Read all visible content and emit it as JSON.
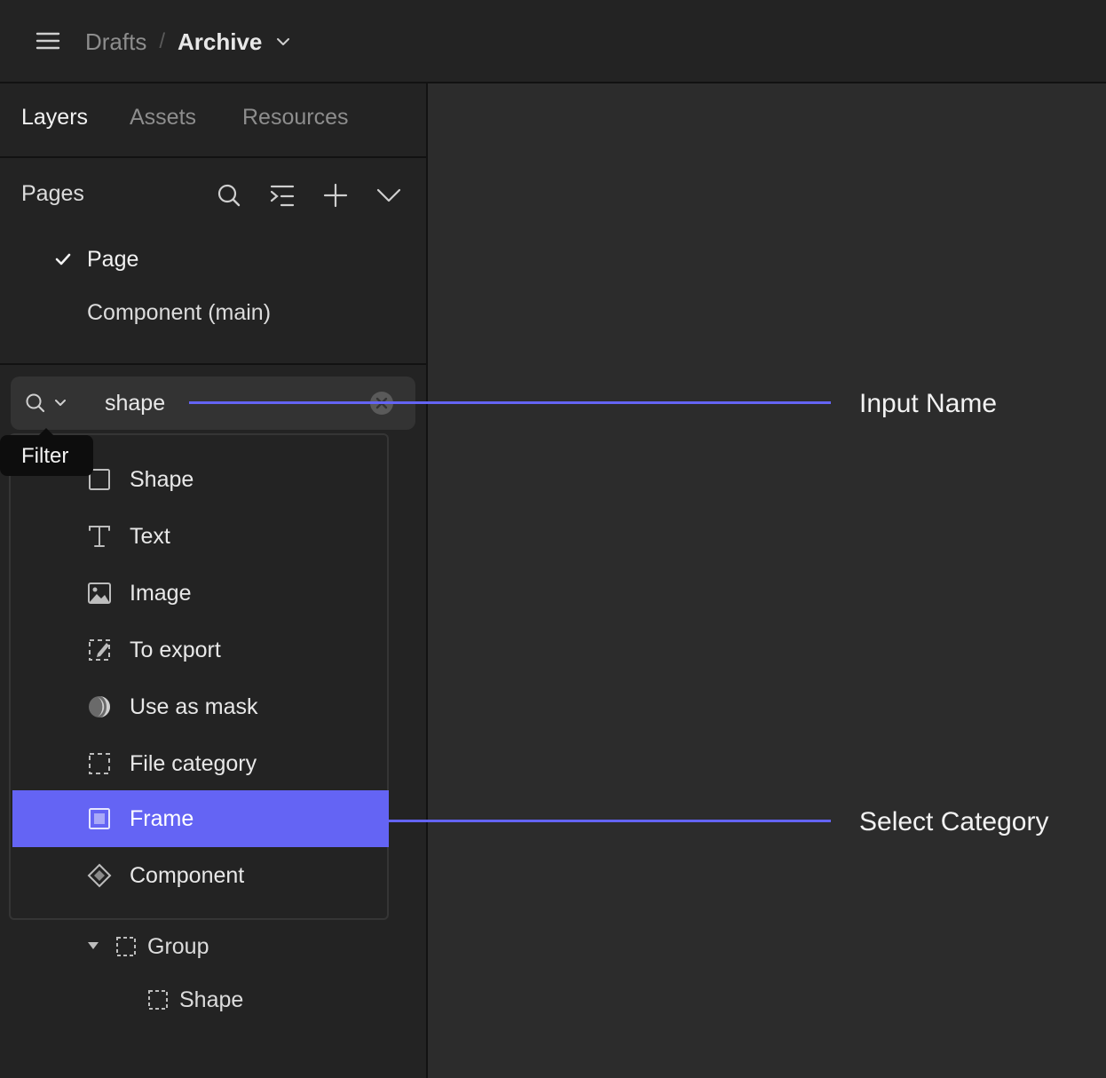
{
  "breadcrumb": {
    "parent": "Drafts",
    "separator": "/",
    "current": "Archive"
  },
  "tabs": [
    {
      "label": "Layers",
      "active": true
    },
    {
      "label": "Assets",
      "active": false
    },
    {
      "label": "Resources",
      "active": false
    }
  ],
  "pages": {
    "title": "Pages",
    "items": [
      {
        "label": "Page",
        "checked": true
      },
      {
        "label": "Component (main)",
        "checked": false
      }
    ]
  },
  "search": {
    "value": "shape",
    "tooltip": "Filter"
  },
  "filter_menu": {
    "items": [
      {
        "label": "Shape",
        "icon": "square-outline-icon"
      },
      {
        "label": "Text",
        "icon": "text-icon"
      },
      {
        "label": "Image",
        "icon": "image-icon"
      },
      {
        "label": "To export",
        "icon": "export-icon"
      },
      {
        "label": "Use as mask",
        "icon": "mask-icon"
      },
      {
        "label": "File category",
        "icon": "dashed-square-icon"
      },
      {
        "label": "Frame",
        "icon": "frame-icon",
        "selected": true
      },
      {
        "label": "Component",
        "icon": "component-icon"
      }
    ]
  },
  "layers": [
    {
      "label": "Group",
      "expanded": true
    },
    {
      "label": "Shape"
    }
  ],
  "annotations": {
    "input_name": "Input Name",
    "select_category": "Select Category"
  },
  "colors": {
    "accent": "#6464f4",
    "panel": "#232323",
    "canvas": "#2c2c2c"
  }
}
